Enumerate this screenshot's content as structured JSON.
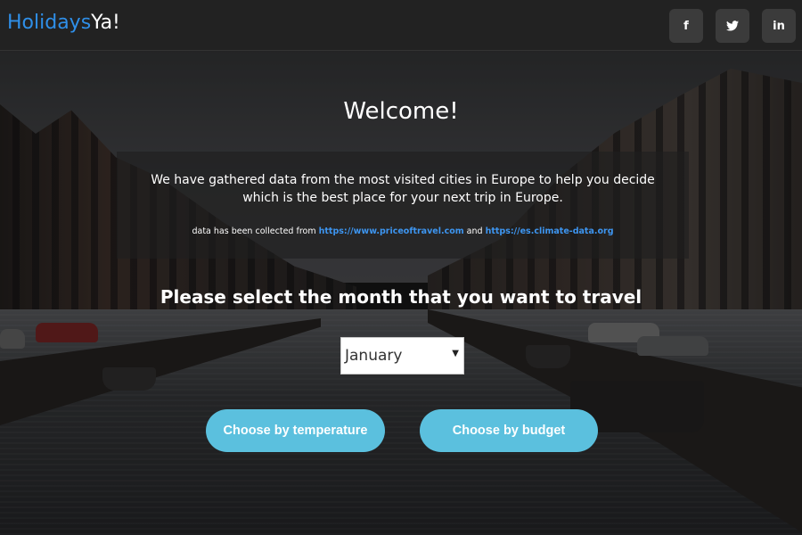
{
  "brand": {
    "part1": "Holidays",
    "part2": "Ya!"
  },
  "social": {
    "facebook": "f",
    "twitter": "🐦",
    "linkedin": "in"
  },
  "hero": {
    "welcome": "Welcome!",
    "intro": "We have gathered data from the most visited cities in Europe to help you decide which is the best place for your next trip in Europe.",
    "credits_prefix": "data has been collected from ",
    "credits_link1": "https://www.priceoftravel.com",
    "credits_and": " and ",
    "credits_link2": "https://es.climate-data.org",
    "prompt": "Please select the month that you want to travel"
  },
  "month_select": {
    "value": "January"
  },
  "buttons": {
    "temperature": "Choose by temperature",
    "budget": "Choose by budget"
  },
  "colors": {
    "brand_blue": "#2f8fe8",
    "button": "#5bc0de",
    "link": "#3d95f0",
    "navbar": "#222222"
  }
}
